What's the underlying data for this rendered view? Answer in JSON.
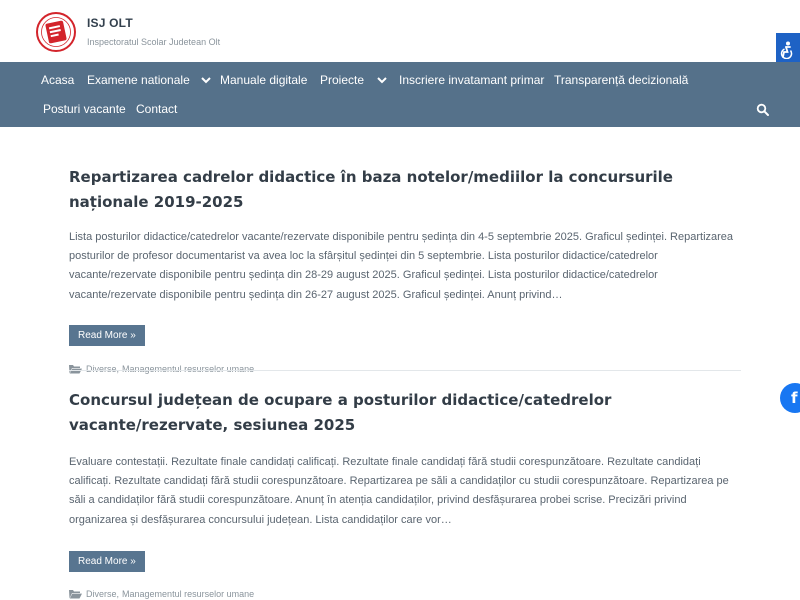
{
  "site": {
    "title": "ISJ OLT",
    "description": "Inspectoratul Scolar Judetean Olt"
  },
  "nav": {
    "items": [
      {
        "label": "Acasa"
      },
      {
        "label": "Examene nationale"
      },
      {
        "label": "Manuale digitale"
      },
      {
        "label": "Proiecte"
      },
      {
        "label": "Inscriere invatamant primar"
      },
      {
        "label": "Transparență decizională"
      },
      {
        "label": "Posturi vacante"
      },
      {
        "label": "Contact"
      }
    ]
  },
  "posts": [
    {
      "title": "Repartizarea cadrelor didactice în baza notelor/mediilor la concursurile naționale 2019-2025",
      "excerpt": "Lista posturilor didactice/catedrelor vacante/rezervate disponibile pentru ședința din 4-5 septembrie 2025. Graficul ședinței. Repartizarea posturilor de profesor documentarist va avea loc la sfârșitul ședinței din 5 septembrie. Lista posturilor didactice/catedrelor vacante/rezervate disponibile pentru ședința din 28-29 august 2025. Graficul ședinței. Lista posturilor didactice/catedrelor vacante/rezervate disponibile pentru ședința din 26-27 august 2025. Graficul ședinței. Anunț privind…",
      "read_more": "Read More »",
      "categories": [
        "Diverse",
        "Managementul resurselor umane"
      ]
    },
    {
      "title": "Concursul județean de ocupare a posturilor didactice/catedrelor vacante/rezervate, sesiunea 2025",
      "excerpt": "Evaluare contestații. Rezultate finale candidați calificați. Rezultate finale candidați fără studii corespunzătoare. Rezultate candidați calificați. Rezultate candidați fără studii corespunzătoare. Repartizarea pe săli a candidaților cu studii corespunzătoare. Repartizarea pe săli a candidaților fără studii corespunzătoare. Anunț în atenția candidaților, privind desfășurarea probei scrise. Precizări privind organizarea și desfășurarea concursului județean. Lista candidaților care vor…",
      "read_more": "Read More »",
      "categories": [
        "Diverse",
        "Managementul resurselor umane"
      ]
    }
  ],
  "icons": {
    "logo": "isj-olt-logo",
    "accessibility": "accessibility-icon",
    "search": "search-icon",
    "facebook": "facebook-icon",
    "folder": "folder-icon",
    "chevron": "chevron-down-icon"
  },
  "colors": {
    "nav_bg": "#55718a",
    "button_bg": "#587590",
    "accessibility_bg": "#1e62c5",
    "facebook_bg": "#1877f2",
    "title_text": "#333d47",
    "logo_red": "#d3242b"
  }
}
